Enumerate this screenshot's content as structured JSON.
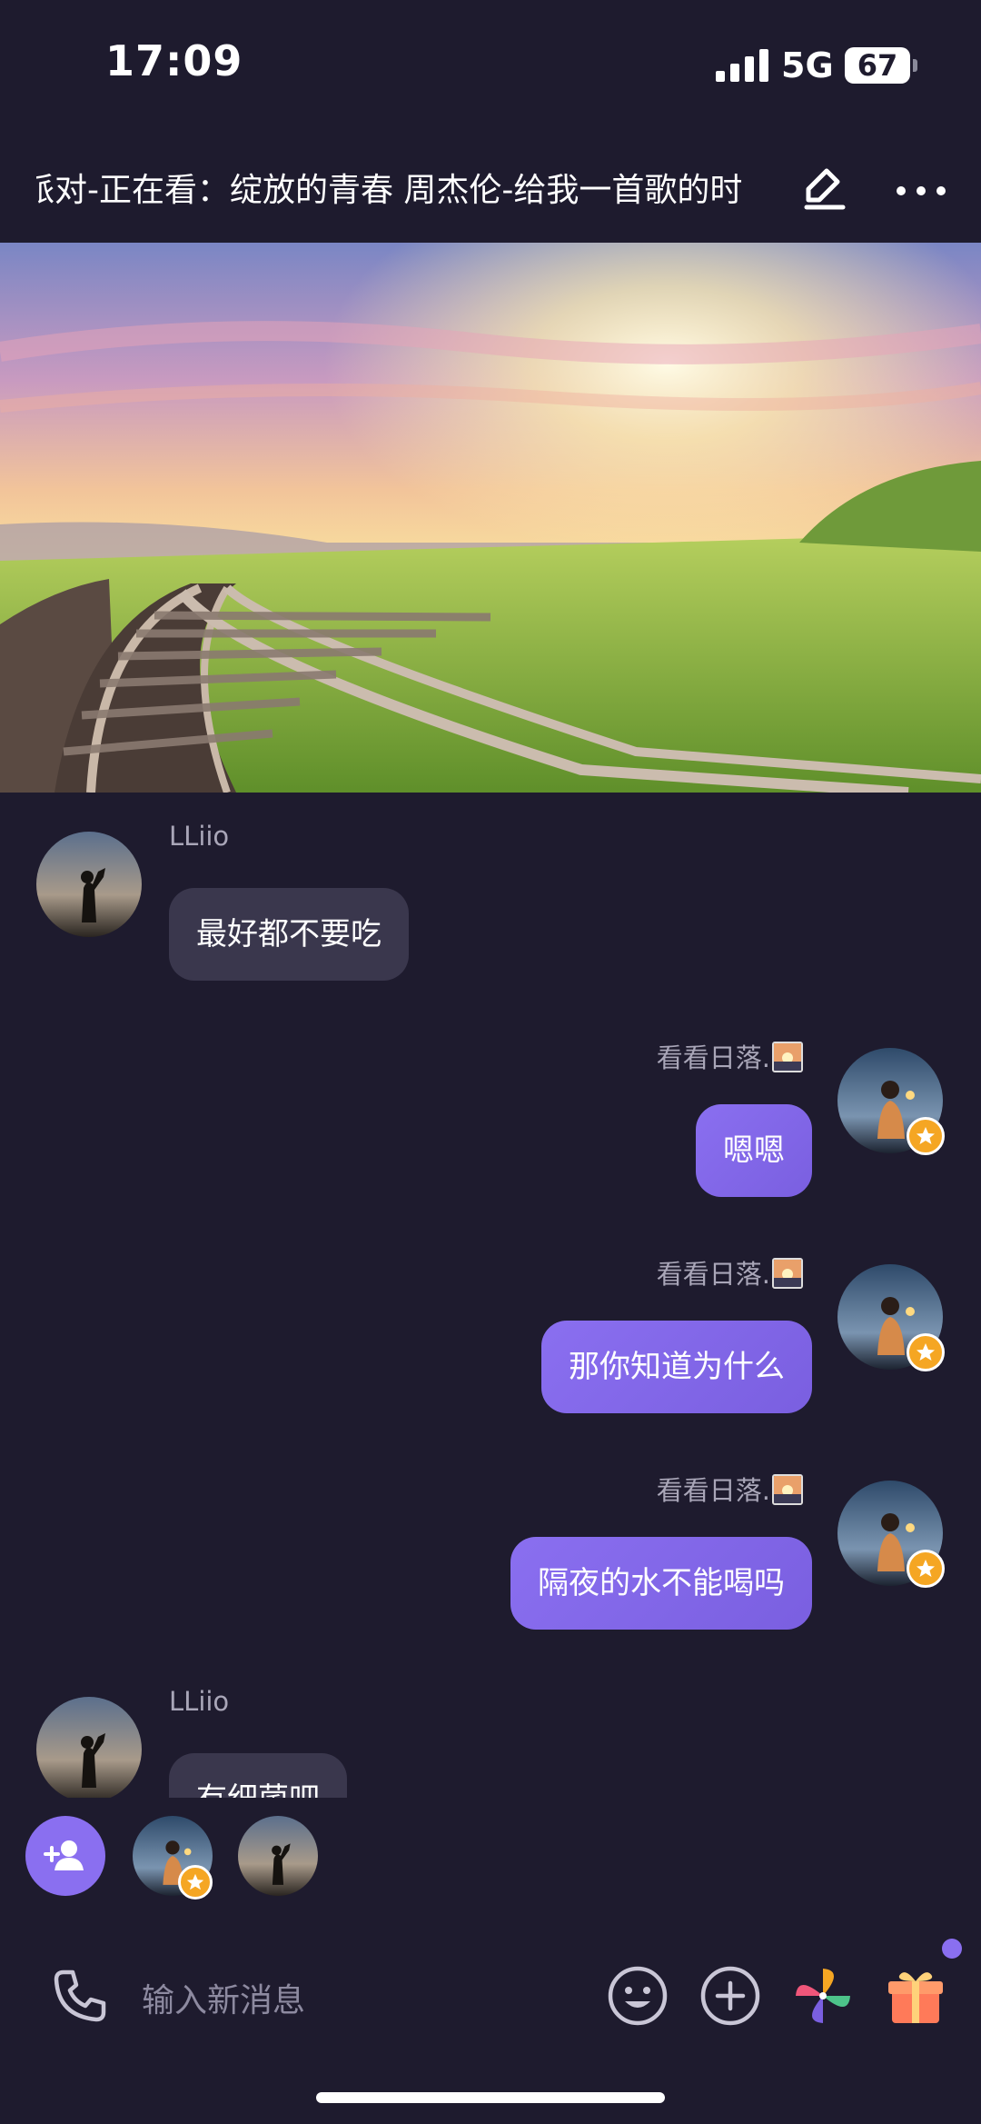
{
  "status_bar": {
    "time": "17:09",
    "network": "5G",
    "battery": "67"
  },
  "header": {
    "title": "派对-正在看：绽放的青春 周杰伦-给我一首歌的时间"
  },
  "messages": [
    {
      "sender": "LLiio",
      "text": "最好都不要吃",
      "direction": "incoming"
    },
    {
      "sender": "看看日落.",
      "text": "嗯嗯",
      "direction": "outgoing"
    },
    {
      "sender": "看看日落.",
      "text": "那你知道为什么",
      "direction": "outgoing"
    },
    {
      "sender": "看看日落.",
      "text": "隔夜的水不能喝吗",
      "direction": "outgoing"
    },
    {
      "sender": "LLiio",
      "text": "有细菌吧",
      "direction": "incoming"
    }
  ],
  "input": {
    "placeholder": "输入新消息"
  },
  "icons": {
    "header": [
      "edit-icon",
      "more-icon"
    ],
    "input_bar": [
      "phone-icon",
      "emoji-icon",
      "plus-icon",
      "pinwheel-icon",
      "gift-icon"
    ],
    "seats": [
      "add-user-icon"
    ]
  },
  "colors": {
    "background": "#1e1b2e",
    "accent": "#8a6ff0",
    "bubble_incoming": "#3a374d",
    "badge": "#f5a623"
  }
}
